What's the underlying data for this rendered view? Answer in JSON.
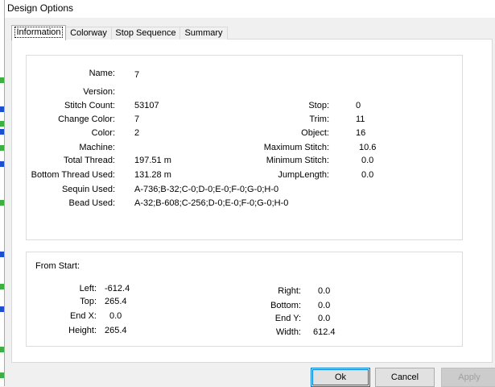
{
  "window": {
    "title": "Design Options"
  },
  "tabs": [
    {
      "label": "Information"
    },
    {
      "label": "Colorway"
    },
    {
      "label": "Stop Sequence"
    },
    {
      "label": "Summary"
    }
  ],
  "info": {
    "name_label": "Name:",
    "name_value": "7",
    "version_label": "Version:",
    "version_value": "",
    "stitch_count_label": "Stitch Count:",
    "stitch_count_value": "53107",
    "change_color_label": "Change Color:",
    "change_color_value": "7",
    "color_label": "Color:",
    "color_value": "2",
    "machine_label": "Machine:",
    "machine_value": "",
    "total_thread_label": "Total Thread:",
    "total_thread_value": "197.51 m",
    "bottom_thread_label": "Bottom Thread Used:",
    "bottom_thread_value": "131.28 m",
    "sequin_label": "Sequin Used:",
    "sequin_value": "A-736;B-32;C-0;D-0;E-0;F-0;G-0;H-0",
    "bead_label": "Bead Used:",
    "bead_value": "A-32;B-608;C-256;D-0;E-0;F-0;G-0;H-0",
    "stop_label": "Stop:",
    "stop_value": "0",
    "trim_label": "Trim:",
    "trim_value": "11",
    "object_label": "Object:",
    "object_value": "16",
    "max_stitch_label": "Maximum Stitch:",
    "max_stitch_value": "10.6",
    "min_stitch_label": "Minimum Stitch:",
    "min_stitch_value": "0.0",
    "jump_length_label": "JumpLength:",
    "jump_length_value": "0.0"
  },
  "from_start": {
    "heading": "From Start:",
    "left_label": "Left:",
    "left_value": "-612.4",
    "top_label": "Top:",
    "top_value": "265.4",
    "endx_label": "End X:",
    "endx_value": "0.0",
    "height_label": "Height:",
    "height_value": "265.4",
    "right_label": "Right:",
    "right_value": "0.0",
    "bottom_label": "Bottom:",
    "bottom_value": "0.0",
    "endy_label": "End Y:",
    "endy_value": "0.0",
    "width_label": "Width:",
    "width_value": "612.4"
  },
  "buttons": {
    "ok": "Ok",
    "cancel": "Cancel",
    "apply": "Apply"
  },
  "colors": {
    "accent": "#0078d7",
    "background": "#f0f0f0",
    "panel": "#ffffff",
    "strip_green": "#3cb043",
    "strip_blue": "#1f4fd1"
  }
}
